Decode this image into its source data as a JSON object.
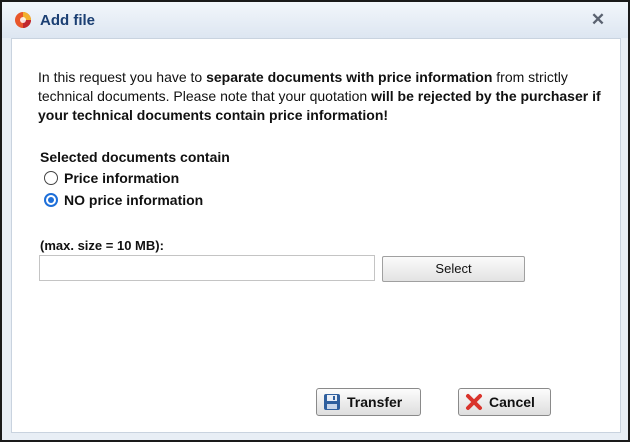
{
  "dialog": {
    "title": "Add file",
    "icon": "app-logo-icon",
    "close_glyph": "✕"
  },
  "intro": {
    "t1": "In this request you have to ",
    "b1": "separate documents with price information",
    "t2": " from strictly technical documents. Please note that your quotation ",
    "b2": "will be rejected by the purchaser if your technical documents contain price information!"
  },
  "selection": {
    "label": "Selected documents contain",
    "options": [
      {
        "label": "Price information",
        "checked": false
      },
      {
        "label": "NO price information",
        "checked": true
      }
    ]
  },
  "upload": {
    "max_size_label": "(max. size = 10 MB):",
    "file_value": "",
    "select_label": "Select"
  },
  "buttons": {
    "transfer": {
      "label": "Transfer",
      "icon": "save-disk-icon"
    },
    "cancel": {
      "label": "Cancel",
      "icon": "red-x-icon"
    }
  },
  "colors": {
    "title_text": "#1b3f73",
    "radio_accent": "#1e6fd9",
    "cancel_icon": "#d9332b",
    "transfer_icon": "#2f5f9e"
  }
}
